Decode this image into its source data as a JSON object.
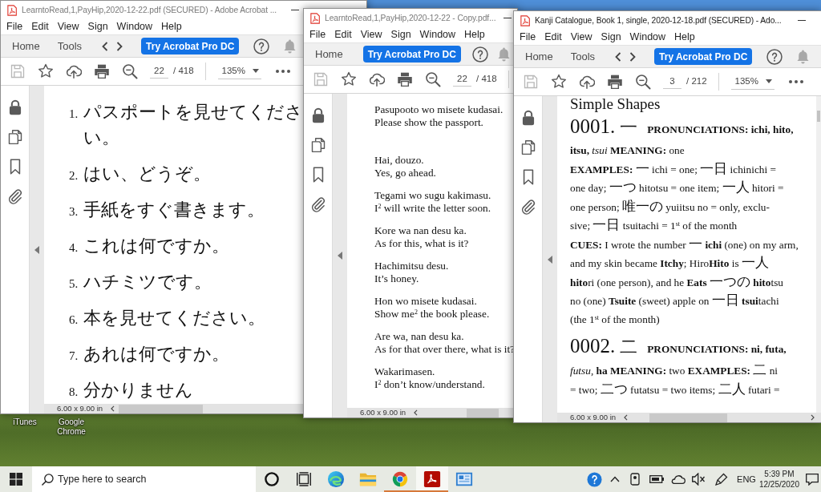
{
  "desktop_icons": [
    {
      "label": "iTunes"
    },
    {
      "label": "Google Chrome"
    }
  ],
  "windows": [
    {
      "title": "LearntoRead,1,PayHip,2020-12-22.pdf (SECURED) - Adobe Acrobat ...",
      "active": false,
      "menu": [
        "File",
        "Edit",
        "View",
        "Sign",
        "Window",
        "Help"
      ],
      "nav": [
        "Home",
        "Tools"
      ],
      "history_arrows": true,
      "promo_button": "Try Acrobat Pro DC",
      "page_number": "22",
      "page_count": "/ 418",
      "zoom": "135%",
      "page_size": "6.00 x 9.00 in",
      "document": {
        "kind": "numbered",
        "items": [
          {
            "number": "1.",
            "text": "パスポートを見せてください。"
          },
          {
            "number": "2.",
            "text": "はい、どうぞ。"
          },
          {
            "number": "3.",
            "text": "手紙をすぐ書きます。"
          },
          {
            "number": "4.",
            "text": "これは何ですか。"
          },
          {
            "number": "5.",
            "text": "ハチミツです。"
          },
          {
            "number": "6.",
            "text": "本を見せてください。"
          },
          {
            "number": "7.",
            "text": "あれは何ですか。"
          },
          {
            "number": "8.",
            "text": "分かりません"
          }
        ]
      }
    },
    {
      "title": "LearntoRead,1,PayHip,2020-12-22 - Copy.pdf...",
      "active": false,
      "menu": [
        "File",
        "Edit",
        "View",
        "Sign",
        "Window",
        "Help"
      ],
      "nav": [
        "Home"
      ],
      "history_arrows": false,
      "promo_button": "Try Acrobat Pro DC",
      "page_number": "22",
      "page_count": "/ 418",
      "page_size": "6.00 x 9.00 in",
      "document": {
        "kind": "phrases",
        "items": [
          {
            "romaji": "Pasupooto wo misete kudasai.",
            "english": "Please show the passport."
          },
          {
            "romaji": "Hai, douzo.",
            "english": "Yes, go ahead."
          },
          {
            "romaji": "Tegami wo sugu kakimasu.",
            "english": "I$^{2}$ will write the letter soon."
          },
          {
            "romaji": "Kore wa nan desu ka.",
            "english": "As for this, what is it?"
          },
          {
            "romaji": "Hachimitsu desu.",
            "english": "It’s honey."
          },
          {
            "romaji": "Hon wo misete kudasai.",
            "english": "Show me$^{2}$ the book please."
          },
          {
            "romaji": "Are wa, nan desu ka.",
            "english": "As for that over there, what is it?"
          },
          {
            "romaji": "Wakarimasen.",
            "english": "I$^{2}$ don’t know/understand."
          }
        ]
      }
    },
    {
      "title": "Kanji Catalogue, Book 1, single, 2020-12-18.pdf (SECURED) - Ado...",
      "active": true,
      "menu": [
        "File",
        "Edit",
        "View",
        "Sign",
        "Window",
        "Help"
      ],
      "nav": [
        "Home",
        "Tools"
      ],
      "history_arrows": true,
      "promo_button": "Try Acrobat Pro DC",
      "page_number": "3",
      "page_count": "/ 212",
      "zoom": "135%",
      "page_size": "6.00 x 9.00 in",
      "document": {
        "kind": "catalogue",
        "blocks": [
          {
            "kind": "heading",
            "text": "Simple Shapes"
          },
          {
            "kind": "entry",
            "number": "0001.",
            "kanji": "一",
            "lines": [
              "**PRONUNCIATIONS: ichi, hito,**",
              "**itsu,** *tsui* **MEANING:** one",
              "**EXAMPLES:** 一 ichi = one; 一日 ichinichi =",
              "one day; 一つ hitotsu = one item; 一人 hitori =",
              "one person; 唯一の yuiitsu no = only, exclu-",
              "sive; 一日 tsuitachi = 1$^{st}$ of the month",
              "**CUES:** I wrote the number 一 **ichi** (one) on my arm,",
              "and my skin became **Itchy**; Hiro**Hito** is 一人",
              "**hito**ri (one person), and he **Eats** 一つの **hito**tsu",
              "no (one) **Tsuite** (sweet) apple on 一日 **tsui**tachi",
              "(the 1$^{st}$ of the month)"
            ]
          },
          {
            "kind": "entry",
            "number": "0002.",
            "kanji": "二",
            "lines": [
              "**PRONUNCIATIONS: ni, futa,**",
              "*futsu*, **ha** **MEANING:** two **EXAMPLES:** 二 ni",
              "= two; 二つ futatsu = two items; 二人 futari ="
            ]
          }
        ]
      }
    }
  ],
  "taskbar": {
    "search": {
      "placeholder": "Type here to search"
    },
    "apps": [
      {
        "kind": "wave",
        "running": false,
        "active": false
      },
      {
        "kind": "folder",
        "running": false,
        "active": false
      },
      {
        "kind": "ring",
        "running": true,
        "active": false
      },
      {
        "kind": "pdf",
        "running": true,
        "active": true
      },
      {
        "kind": "panel",
        "running": false,
        "active": false
      }
    ],
    "language": "ENG",
    "time": "5:39 PM",
    "date": "12/25/2020"
  }
}
